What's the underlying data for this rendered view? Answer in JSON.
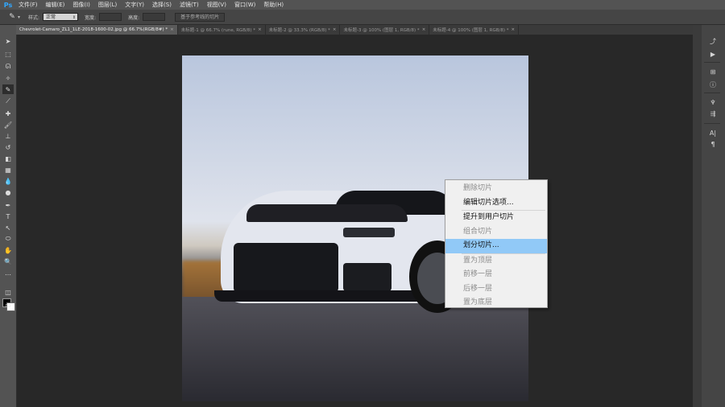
{
  "app": {
    "logo": "Ps"
  },
  "menubar": {
    "items": [
      "文件(F)",
      "编辑(E)",
      "图像(I)",
      "图层(L)",
      "文字(Y)",
      "选择(S)",
      "滤镜(T)",
      "视图(V)",
      "窗口(W)",
      "帮助(H)"
    ]
  },
  "options_bar": {
    "tool_icon": "slice-tool-icon",
    "style_label": "样式:",
    "style_value": "正常",
    "width_label": "宽度:",
    "height_label": "高度:",
    "guides_button": "基于参考线的切片"
  },
  "document_tabs": [
    {
      "title": "Chevrolet-Camaro_ZL1_1LE-2018-1600-02.jpg @ 66.7%(RGB/8#) *",
      "active": true
    },
    {
      "title": "未标题-1 @ 66.7% (rune, RGB/8) *",
      "active": false
    },
    {
      "title": "未标题-2 @ 33.3% (RGB/8) *",
      "active": false
    },
    {
      "title": "未标题-3 @ 100% (图层 1, RGB/8) *",
      "active": false
    },
    {
      "title": "未标题-4 @ 100% (图层 1, RGB/8) *",
      "active": false
    }
  ],
  "context_menu": {
    "groups": [
      [
        {
          "label": "删除切片",
          "enabled": false
        },
        {
          "label": "编辑切片选项...",
          "enabled": true
        }
      ],
      [
        {
          "label": "提升到用户切片",
          "enabled": true
        },
        {
          "label": "组合切片",
          "enabled": false
        },
        {
          "label": "划分切片...",
          "enabled": true,
          "highlighted": true
        }
      ],
      [
        {
          "label": "置为顶层",
          "enabled": false
        },
        {
          "label": "前移一层",
          "enabled": false
        },
        {
          "label": "后移一层",
          "enabled": false
        },
        {
          "label": "置为底层",
          "enabled": false
        }
      ]
    ]
  },
  "colors": {
    "foreground": "#000000",
    "background": "#ffffff",
    "menu_highlight": "#91c9f7",
    "ps_blue": "#31a8ff"
  }
}
